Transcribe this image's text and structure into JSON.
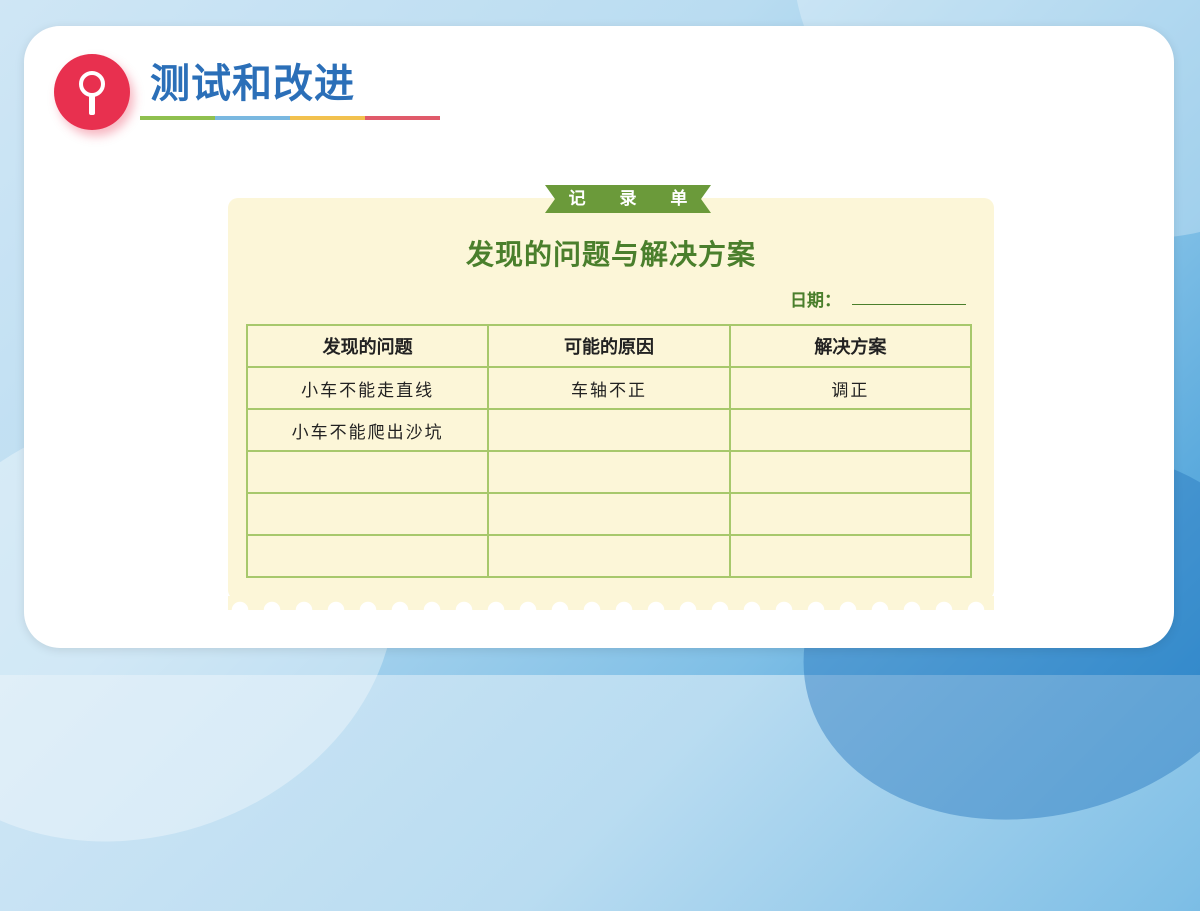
{
  "page": {
    "title": "测试和改进",
    "underline_colors": [
      "#8fc04f",
      "#7ab8e0",
      "#f2c14e",
      "#e05a6a"
    ]
  },
  "sheet": {
    "ribbon_label": "记 录 单",
    "heading": "发现的问题与解决方案",
    "date_label": "日期：",
    "columns": [
      "发现的问题",
      "可能的原因",
      "解决方案"
    ],
    "rows": [
      [
        "小车不能走直线",
        "车轴不正",
        "调正"
      ],
      [
        "小车不能爬出沙坑",
        "",
        ""
      ],
      [
        "",
        "",
        ""
      ],
      [
        "",
        "",
        ""
      ],
      [
        "",
        "",
        ""
      ]
    ]
  },
  "colors": {
    "accent_red": "#e8304f",
    "title_blue": "#2b6fb8",
    "sheet_green": "#4a7f2c",
    "grid_green": "#a7c86c",
    "paper": "#fcf6d8"
  },
  "icons": {
    "badge": "magnifier-icon"
  }
}
